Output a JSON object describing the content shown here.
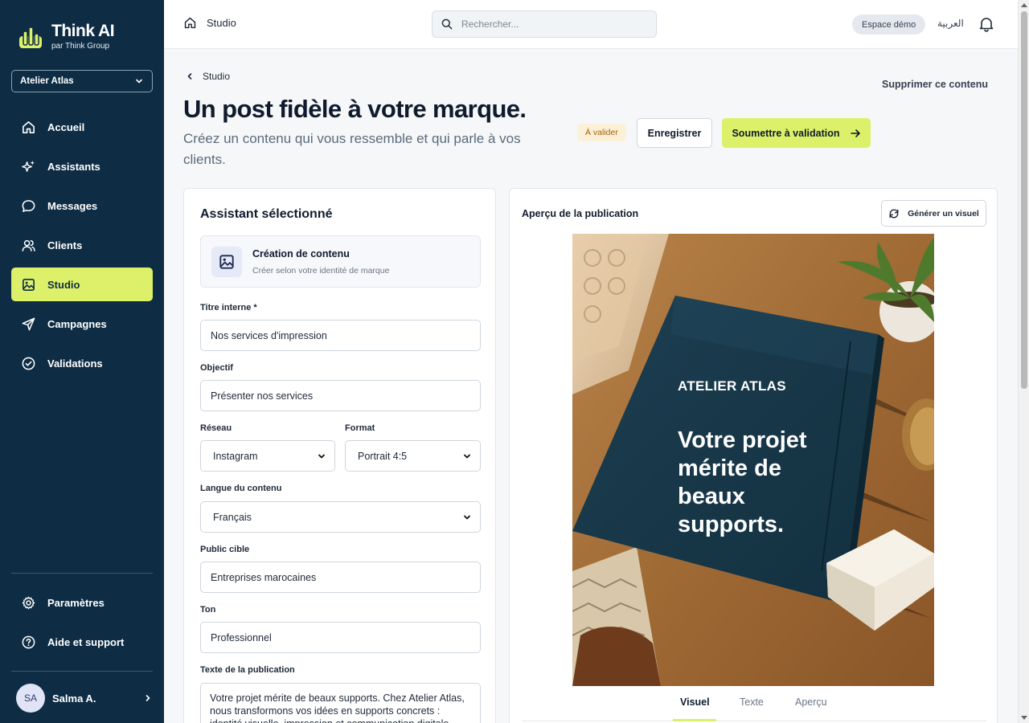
{
  "app": {
    "name": "Think AI",
    "subtitle": "par Think Group",
    "workspace": "Atelier Atlas"
  },
  "sidebar": {
    "items": [
      {
        "label": "Accueil",
        "icon": "home-icon"
      },
      {
        "label": "Assistants",
        "icon": "sparkles-icon"
      },
      {
        "label": "Messages",
        "icon": "message-icon"
      },
      {
        "label": "Clients",
        "icon": "users-icon"
      },
      {
        "label": "Studio",
        "icon": "image-icon",
        "active": true
      },
      {
        "label": "Campagnes",
        "icon": "send-icon"
      },
      {
        "label": "Validations",
        "icon": "check-circle-icon"
      }
    ],
    "bottom": [
      {
        "label": "Paramètres",
        "icon": "gear-icon"
      },
      {
        "label": "Aide et support",
        "icon": "help-icon"
      }
    ],
    "user": {
      "initials": "SA",
      "name": "Salma A."
    }
  },
  "topbar": {
    "breadcrumb": "Studio",
    "search_placeholder": "Rechercher...",
    "demo_label": "Espace démo",
    "lang_label": "العربية"
  },
  "header": {
    "back_label": "Studio",
    "delete_label": "Supprimer ce contenu",
    "title": "Un post fidèle à votre marque.",
    "subtitle": "Créez un contenu qui vous ressemble et qui parle à vos clients.",
    "status": "À valider",
    "save_label": "Enregistrer",
    "submit_label": "Soumettre à validation"
  },
  "form": {
    "card_title": "Assistant sélectionné",
    "assistant": {
      "name": "Création de contenu",
      "description": "Créer selon votre identité de marque"
    },
    "internal_title": {
      "label": "Titre interne *",
      "value": "Nos services d'impression"
    },
    "objective": {
      "label": "Objectif",
      "value": "Présenter nos services"
    },
    "network": {
      "label": "Réseau",
      "value": "Instagram"
    },
    "format": {
      "label": "Format",
      "value": "Portrait 4:5"
    },
    "language": {
      "label": "Langue du contenu",
      "value": "Français"
    },
    "audience": {
      "label": "Public cible",
      "value": "Entreprises marocaines"
    },
    "tone": {
      "label": "Ton",
      "value": "Professionnel"
    },
    "post_text": {
      "label": "Texte de la publication",
      "value": "Votre projet mérite de beaux supports. Chez Atelier Atlas, nous transformons vos idées en supports concrets : identité visuelle, impression et communication digitale."
    }
  },
  "preview": {
    "title": "Aperçu de la publication",
    "generate_label": "Générer un visuel",
    "post_brand": "ATELIER ATLAS",
    "post_headline": "Votre projet mérite de beaux supports.",
    "tabs": [
      "Visuel",
      "Texte",
      "Aperçu"
    ],
    "active_tab": "Visuel"
  },
  "colors": {
    "sidebar": "#0e2d45",
    "accent": "#dcf06a",
    "status_bg": "#fdf0d9",
    "status_text": "#a36300"
  }
}
